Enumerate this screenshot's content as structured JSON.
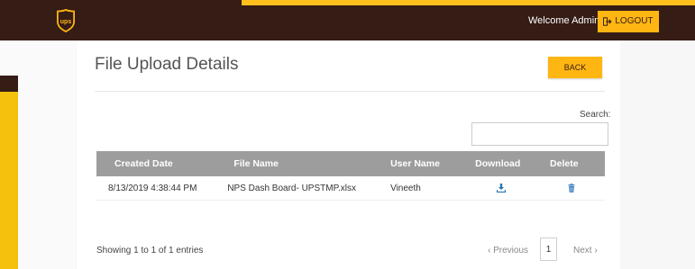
{
  "header": {
    "welcome_text": "Welcome Admin",
    "logout_label": "LOGOUT",
    "brand_color": "#351c15",
    "accent_color": "#ffb612",
    "logo_icon": "ups-shield-logo"
  },
  "page": {
    "title": "File Upload Details",
    "back_label": "BACK"
  },
  "search": {
    "label": "Search:",
    "value": "",
    "placeholder": ""
  },
  "table": {
    "headers": [
      "Created Date",
      "File Name",
      "User Name",
      "Download",
      "Delete"
    ],
    "rows": [
      {
        "created_date": "8/13/2019 4:38:44 PM",
        "file_name": "NPS Dash Board- UPSTMP.xlsx",
        "user_name": "Vineeth",
        "download_icon": "download-icon",
        "delete_icon": "trash-icon"
      }
    ]
  },
  "footer": {
    "showing": "Showing 1 to 1 of 1 entries",
    "previous": "‹ Previous",
    "page": "1",
    "next": "Next ›"
  }
}
